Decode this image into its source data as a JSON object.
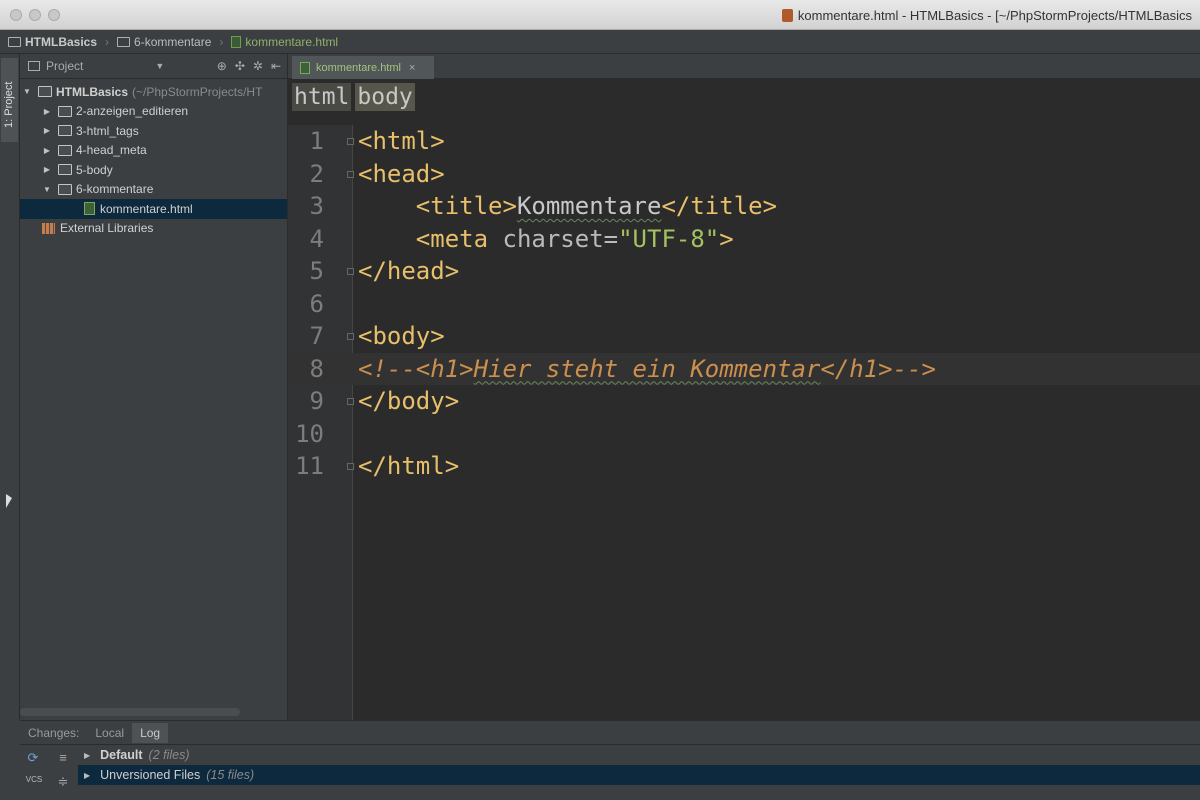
{
  "window": {
    "title": "kommentare.html - HTMLBasics - [~/PhpStormProjects/HTMLBasics"
  },
  "breadcrumb": [
    {
      "label": "HTMLBasics",
      "type": "folder"
    },
    {
      "label": "6-kommentare",
      "type": "folder"
    },
    {
      "label": "kommentare.html",
      "type": "file"
    }
  ],
  "left_strip": {
    "tab_label": "1: Project"
  },
  "project_panel": {
    "header": "Project",
    "root": {
      "label": "HTMLBasics",
      "path": "(~/PhpStormProjects/HT"
    },
    "folders": [
      {
        "label": "2-anzeigen_editieren",
        "expanded": false
      },
      {
        "label": "3-html_tags",
        "expanded": false
      },
      {
        "label": "4-head_meta",
        "expanded": false
      },
      {
        "label": "5-body",
        "expanded": false
      },
      {
        "label": "6-kommentare",
        "expanded": true
      }
    ],
    "selected_file": "kommentare.html",
    "external_libraries": "External Libraries"
  },
  "editor": {
    "tab_label": "kommentare.html",
    "tag_breadcrumb": [
      "html",
      "body"
    ],
    "line_numbers": [
      "1",
      "2",
      "3",
      "4",
      "5",
      "6",
      "7",
      "8",
      "9",
      "10",
      "11"
    ],
    "lines": {
      "l1": "<html>",
      "l2": "<head>",
      "l3_open": "    <title>",
      "l3_text": "Kommentare",
      "l3_close": "</title>",
      "l4_open": "    <meta",
      "l4_attr": " charset=",
      "l4_str": "\"UTF-8\"",
      "l4_close": ">",
      "l5": "</head>",
      "l7": "<body>",
      "l8_a": "<!--<h1>",
      "l8_b": "Hier steht ein Kommentar",
      "l8_c": "</h1>-->",
      "l9": "</body>",
      "l11": "</html>"
    }
  },
  "changes_panel": {
    "label": "Changes:",
    "tabs": [
      "Local",
      "Log"
    ],
    "vcs_label": "VCS",
    "rows": [
      {
        "label": "Default",
        "count": "(2 files)"
      },
      {
        "label": "Unversioned Files",
        "count": "(15 files)"
      }
    ]
  }
}
